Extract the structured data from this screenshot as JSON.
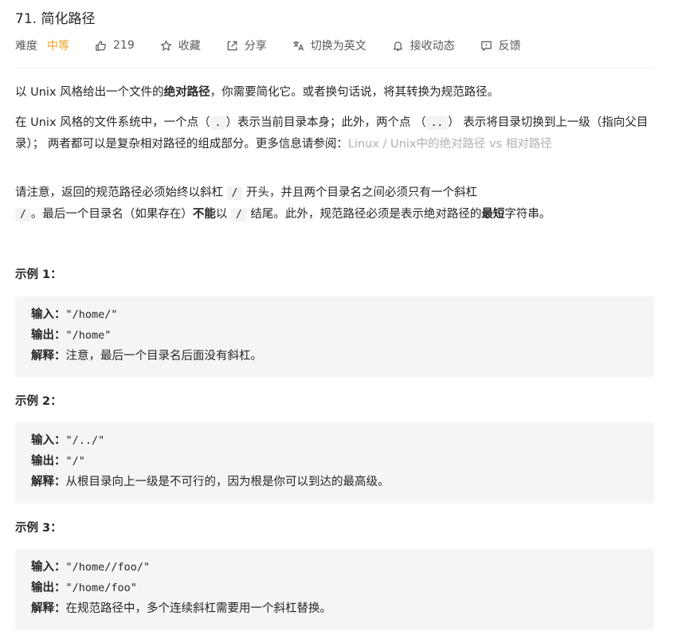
{
  "problem": {
    "title": "71. 简化路径",
    "difficulty_label": "难度",
    "difficulty_value": "中等",
    "likes": "219",
    "favorite": "收藏",
    "share": "分享",
    "switch_lang": "切换为英文",
    "notify": "接收动态",
    "feedback": "反馈"
  },
  "desc": {
    "p1_a": "以 Unix 风格给出一个文件的",
    "p1_b": "绝对路径",
    "p1_c": "，你需要简化它。或者换句话说，将其转换为规范路径。",
    "p2_a": "在 Unix 风格的文件系统中，一个点（",
    "p2_code1": ".",
    "p2_b": "）表示当前目录本身；此外，两个点 （",
    "p2_code2": "..",
    "p2_c": "） 表示将目录切换到上一级（指向父目录）； 两者都可以是复杂相对路径的组成部分。更多信息请参阅：",
    "p2_link": "Linux / Unix中的绝对路径 vs 相对路径",
    "p3_a": "请注意，返回的规范路径必须始终以斜杠 ",
    "p3_code1": "/",
    "p3_b": " 开头，并且两个目录名之间必须只有一个斜杠 ",
    "p3_code2": "/",
    "p3_c": "。最后一个目录名（如果存在）",
    "p3_bold1": "不能",
    "p3_d": "以 ",
    "p3_code3": "/",
    "p3_e": " 结尾。此外，规范路径必须是表示绝对路径的",
    "p3_bold2": "最短",
    "p3_f": "字符串。"
  },
  "examples": [
    {
      "title": "示例 1：",
      "input_k": "输入：",
      "input_v": "\"/home/\"",
      "output_k": "输出：",
      "output_v": "\"/home\"",
      "explain_k": "解释：",
      "explain_v": "注意，最后一个目录名后面没有斜杠。"
    },
    {
      "title": "示例 2：",
      "input_k": "输入：",
      "input_v": "\"/../\"",
      "output_k": "输出：",
      "output_v": "\"/\"",
      "explain_k": "解释：",
      "explain_v": "从根目录向上一级是不可行的，因为根是你可以到达的最高级。"
    },
    {
      "title": "示例 3：",
      "input_k": "输入：",
      "input_v": "\"/home//foo/\"",
      "output_k": "输出：",
      "output_v": "\"/home/foo\"",
      "explain_k": "解释：",
      "explain_v": "在规范路径中，多个连续斜杠需要用一个斜杠替换。"
    }
  ],
  "icons": {
    "like": "thumbs-up-icon",
    "favorite": "star-icon",
    "share": "share-icon",
    "switch": "translate-icon",
    "notify": "bell-icon",
    "feedback": "feedback-icon"
  },
  "colors": {
    "difficulty_medium": "#f0a020",
    "link_muted": "#b0b0b0",
    "example_bg": "#f5f5f5"
  }
}
